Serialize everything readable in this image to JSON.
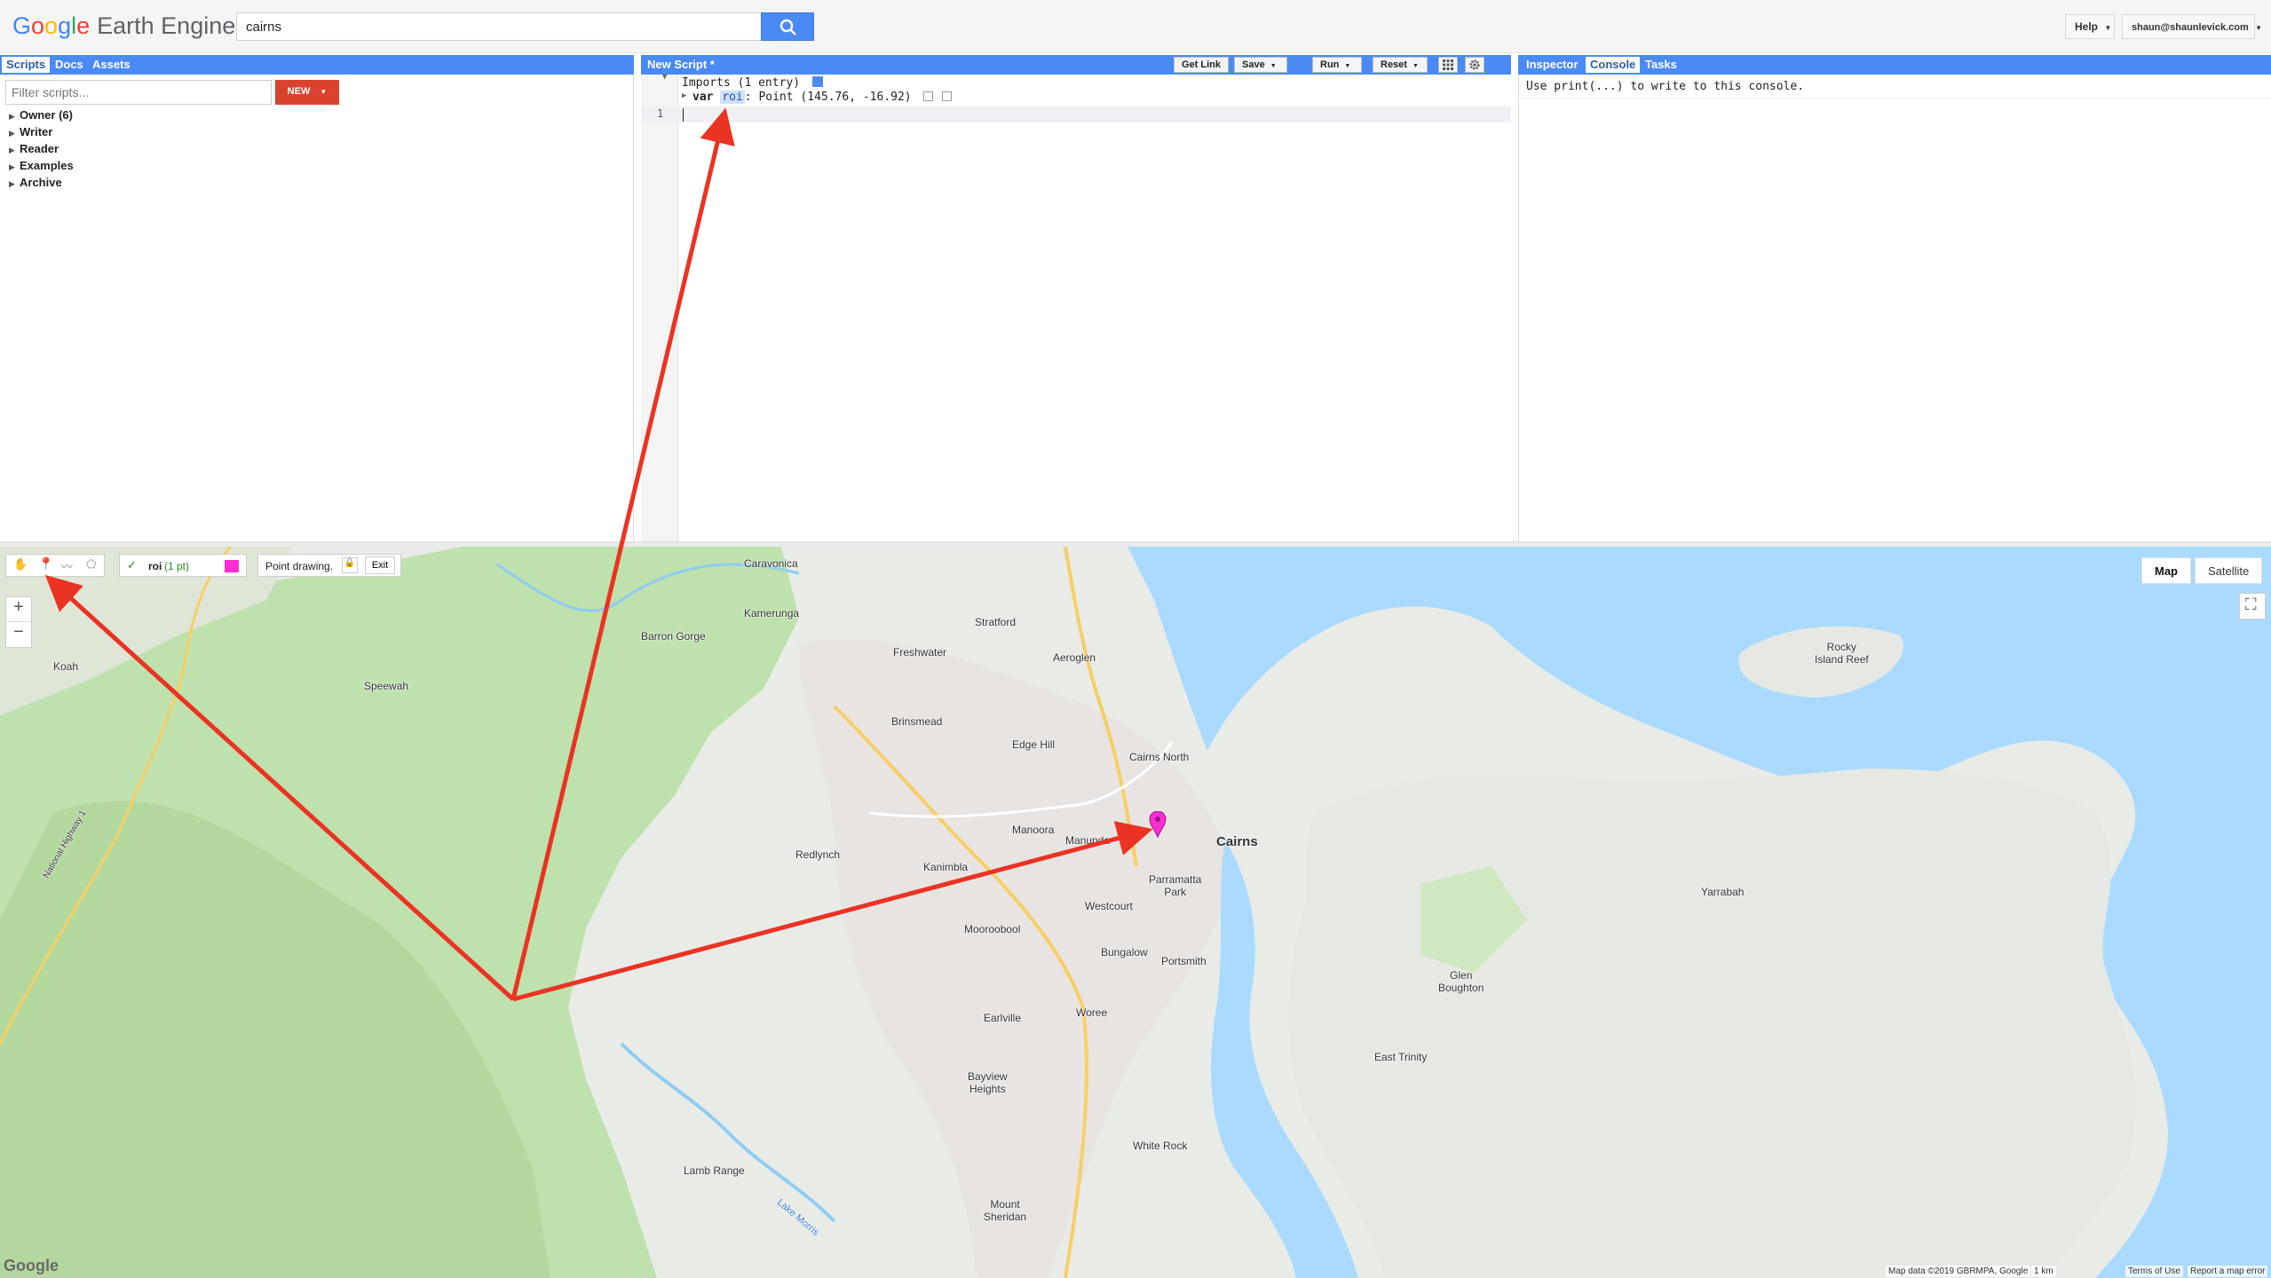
{
  "header": {
    "logo_g1": "G",
    "logo_g2": "o",
    "logo_g3": "o",
    "logo_g4": "g",
    "logo_g5": "l",
    "logo_g6": "e",
    "logo_rest": "Earth Engine",
    "search_value": "cairns",
    "help_label": "Help",
    "account_label": "shaun@shaunlevick.com"
  },
  "left_panel": {
    "tabs": [
      "Scripts",
      "Docs",
      "Assets"
    ],
    "filter_placeholder": "Filter scripts...",
    "new_label": "NEW",
    "tree": [
      "Owner  (6)",
      "Writer",
      "Reader",
      "Examples",
      "Archive"
    ]
  },
  "editor": {
    "title": "New Script *",
    "get_link_label": "Get Link",
    "save_label": "Save",
    "run_label": "Run",
    "reset_label": "Reset",
    "imports_line": "Imports (1 entry)",
    "var_keyword": "var",
    "var_name": "roi",
    "var_value": ": Point (145.76, -16.92)",
    "line_number": "1"
  },
  "right_panel": {
    "tabs": [
      "Inspector",
      "Console",
      "Tasks"
    ],
    "console_text": "Use print(...) to write to this console."
  },
  "map": {
    "layer_name": "roi",
    "layer_count": "(1 pt)",
    "layer_color": "#ff2dd4",
    "drawing_status": "Point drawing.",
    "exit_label": "Exit",
    "zoom_in": "+",
    "zoom_out": "−",
    "type_map": "Map",
    "type_satellite": "Satellite",
    "google_logo": "Google",
    "map_data": "Map data ©2019 GBRMPA, Google",
    "scale": "1 km",
    "terms": "Terms of Use",
    "report": "Report a map error",
    "places": {
      "caravonica": "Caravonica",
      "kamerunga": "Kamerunga",
      "barron_gorge": "Barron Gorge",
      "stratford": "Stratford",
      "freshwater": "Freshwater",
      "aeroglen": "Aeroglen",
      "koah": "Koah",
      "speewah": "Speewah",
      "brinsmead": "Brinsmead",
      "edge_hill": "Edge Hill",
      "cairns_north": "Cairns North",
      "manoora": "Manoora",
      "manunda": "Manunda",
      "cairns": "Cairns",
      "redlynch": "Redlynch",
      "kanimbla": "Kanimbla",
      "parramatta_park": "Parramatta\nPark",
      "westcourt": "Westcourt",
      "mooroobool": "Mooroobool",
      "bungalow": "Bungalow",
      "portsmith": "Portsmith",
      "woree": "Woree",
      "earlville": "Earlville",
      "bayview_heights": "Bayview\nHeights",
      "white_rock": "White Rock",
      "lamb_range": "Lamb Range",
      "mount_sheridan": "Mount\nSheridan",
      "east_trinity": "East Trinity",
      "glen_boughton": "Glen\nBoughton",
      "yarrabah": "Yarrabah",
      "rocky_island_reef": "Rocky\nIsland Reef",
      "lake_morris": "Lake Morris",
      "national_highway": "National Highway 1"
    }
  }
}
